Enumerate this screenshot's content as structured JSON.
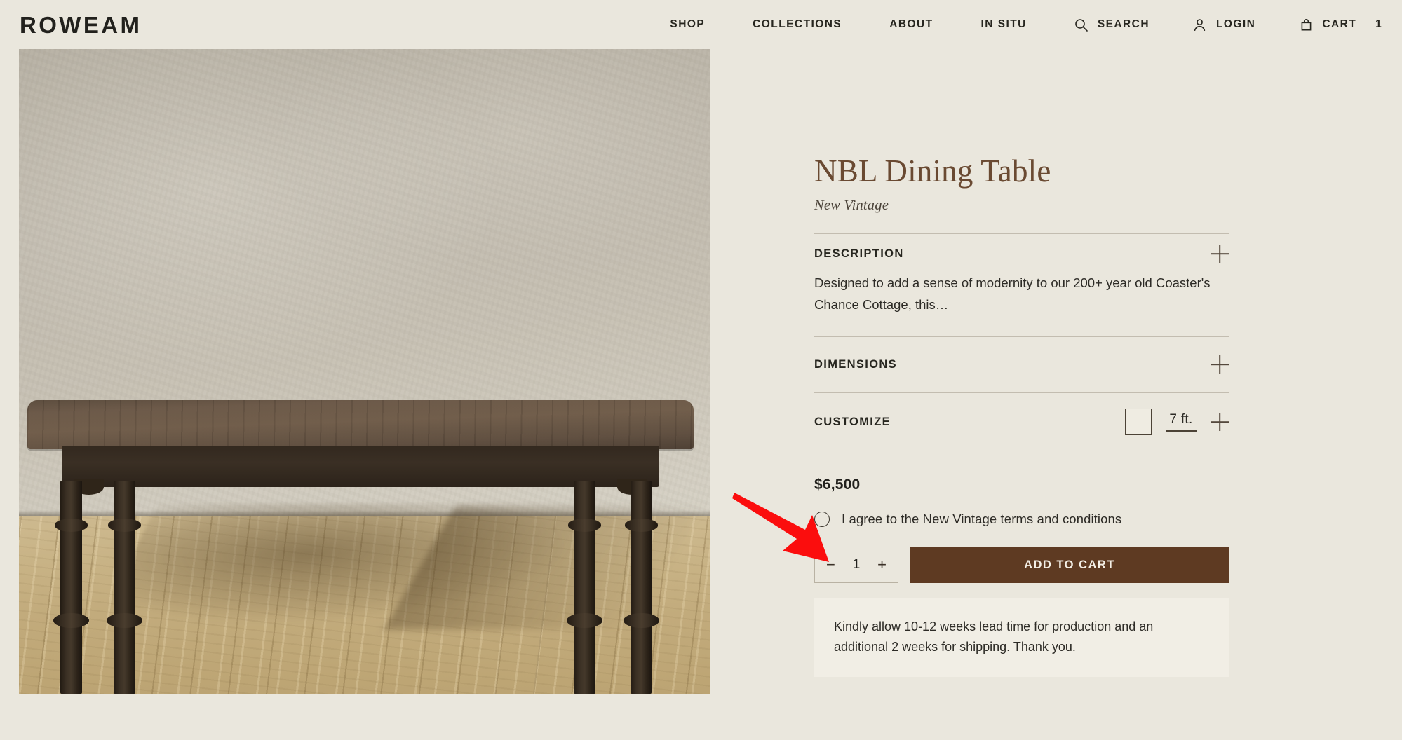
{
  "header": {
    "brand": "ROWEAM",
    "nav": [
      {
        "label": "SHOP",
        "name": "nav-shop"
      },
      {
        "label": "COLLECTIONS",
        "name": "nav-collections"
      },
      {
        "label": "ABOUT",
        "name": "nav-about"
      },
      {
        "label": "IN SITU",
        "name": "nav-in-situ"
      }
    ],
    "search": {
      "label": "SEARCH",
      "icon": "search-icon"
    },
    "login": {
      "label": "LOGIN",
      "icon": "user-icon"
    },
    "cart": {
      "label": "CART",
      "icon": "shopping-bag-icon",
      "count": "1"
    }
  },
  "product": {
    "title": "NBL Dining Table",
    "collection": "New Vintage",
    "price": "$6,500",
    "image_alt": "Dark wood NBL dining table with turned legs against a plaster wall on a wood floor",
    "sections": {
      "description": {
        "label": "DESCRIPTION",
        "body": "Designed to add a sense of modernity to our 200+ year old Coaster's Chance Cottage, this…",
        "toggle_icon": "plus-icon"
      },
      "dimensions": {
        "label": "DIMENSIONS",
        "toggle_icon": "plus-icon"
      },
      "customize": {
        "label": "CUSTOMIZE",
        "swatch_name": "wood-finish-swatch",
        "size_value": "7 ft.",
        "toggle_icon": "plus-icon"
      }
    },
    "terms": {
      "label": "I agree to the New Vintage terms and conditions",
      "checked": false
    },
    "quantity": {
      "value": "1",
      "decrement": "−",
      "increment": "+"
    },
    "add_to_cart_label": "ADD TO CART",
    "lead_time_notice": "Kindly allow 10-12 weeks lead time for production and an additional 2 weeks for shipping. Thank you."
  },
  "annotation": {
    "type": "arrow",
    "color": "#fb0d0d",
    "points_to": "terms-checkbox"
  },
  "colors": {
    "page_background": "#eae7dd",
    "title_brown": "#6a4a32",
    "cta_brown": "#5e3a22",
    "divider": "#c3bdb0",
    "notice_background": "#f1eee5",
    "text": "#2d2b26"
  }
}
